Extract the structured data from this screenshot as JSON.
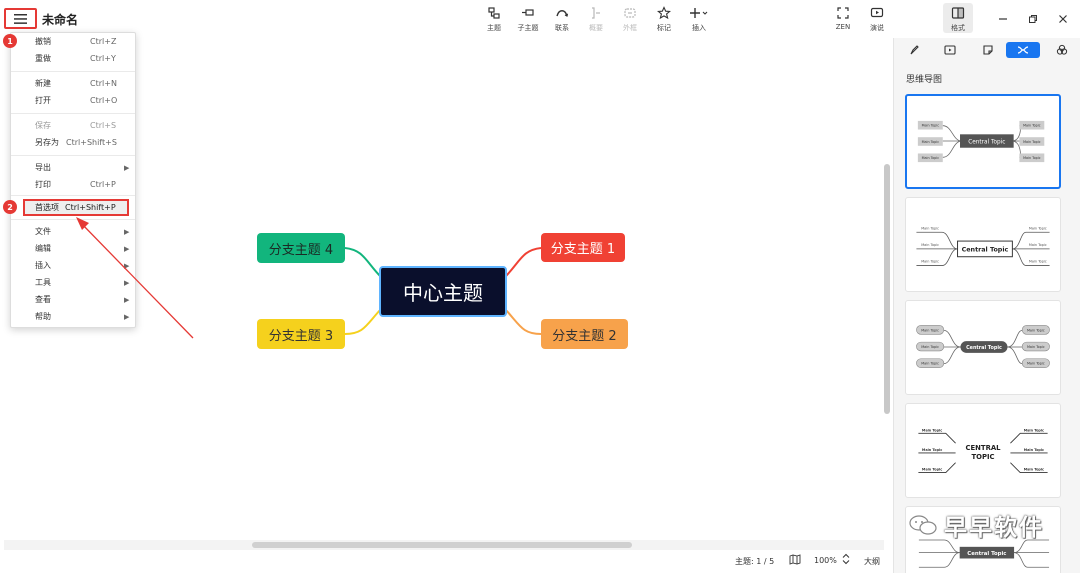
{
  "document": {
    "title": "未命名"
  },
  "toolbar": {
    "items": [
      {
        "label": "主题",
        "icon": "topic-icon"
      },
      {
        "label": "子主题",
        "icon": "subtopic-icon"
      },
      {
        "label": "联系",
        "icon": "relationship-icon"
      },
      {
        "label": "概要",
        "icon": "summary-icon"
      },
      {
        "label": "外框",
        "icon": "boundary-icon"
      },
      {
        "label": "标记",
        "icon": "star-icon"
      },
      {
        "label": "插入",
        "icon": "plus-icon"
      },
      {
        "label": "ZEN",
        "icon": "fullscreen-icon"
      },
      {
        "label": "演说",
        "icon": "pitch-icon"
      },
      {
        "label": "格式",
        "icon": "format-panel-icon"
      }
    ]
  },
  "menu": {
    "badge1": "1",
    "badge2": "2",
    "items": [
      {
        "label": "撤销",
        "shortcut": "Ctrl+Z"
      },
      {
        "label": "重做",
        "shortcut": "Ctrl+Y"
      },
      {
        "label": "新建",
        "shortcut": "Ctrl+N"
      },
      {
        "label": "打开",
        "shortcut": "Ctrl+O"
      },
      {
        "label": "保存",
        "shortcut": "Ctrl+S"
      },
      {
        "label": "另存为",
        "shortcut": "Ctrl+Shift+S"
      },
      {
        "label": "导出",
        "shortcut": ""
      },
      {
        "label": "打印",
        "shortcut": "Ctrl+P"
      },
      {
        "label": "首选项",
        "shortcut": "Ctrl+Shift+P"
      },
      {
        "label": "文件",
        "shortcut": ""
      },
      {
        "label": "编辑",
        "shortcut": ""
      },
      {
        "label": "插入",
        "shortcut": ""
      },
      {
        "label": "工具",
        "shortcut": ""
      },
      {
        "label": "查看",
        "shortcut": ""
      },
      {
        "label": "帮助",
        "shortcut": ""
      }
    ],
    "submenu_arrow": "▶"
  },
  "mindmap": {
    "central": "中心主题",
    "branches": [
      "分支主题 1",
      "分支主题 2",
      "分支主题 3",
      "分支主题 4"
    ],
    "colors": {
      "central": "#0a0f2c",
      "b1": "#f04134",
      "b2": "#f7a24b",
      "b3": "#f5d11d",
      "b4": "#12b57d"
    }
  },
  "panel": {
    "title": "思维导图",
    "theme_central": [
      "Central Topic",
      "Central Topic",
      "Central Topic",
      "CENTRAL\nTOPIC",
      "Central Topic"
    ],
    "theme_main": "Main Topic"
  },
  "status": {
    "topic_count": "主题: 1 / 5",
    "zoom": "100%",
    "outline": "大纲"
  },
  "watermark": {
    "text": "早早软件"
  },
  "colors": {
    "accent": "#1976f0",
    "highlight": "#e53935"
  }
}
